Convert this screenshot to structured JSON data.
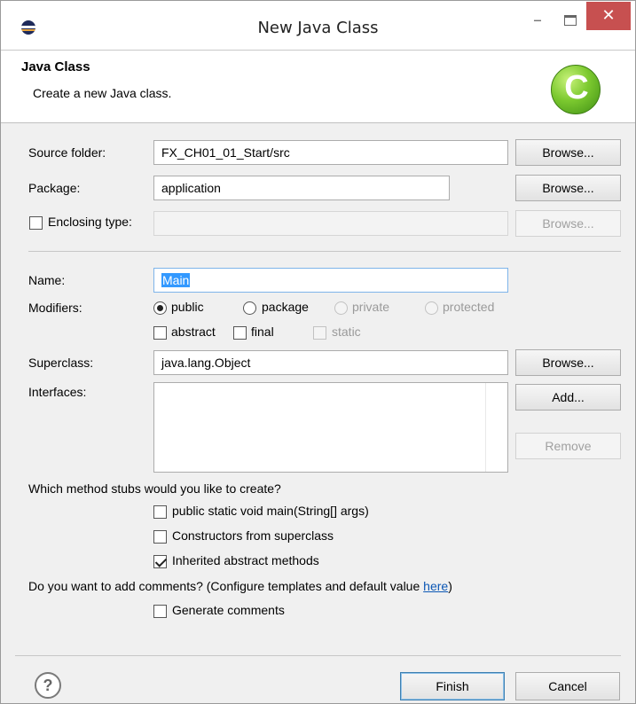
{
  "window": {
    "title": "New Java Class",
    "minimize_glyph": "–",
    "close_glyph": "✕",
    "icon": "eclipse-icon"
  },
  "banner": {
    "title": "Java Class",
    "description": "Create a new Java class.",
    "logo_letter": "C",
    "logo_icon": "java-class-icon"
  },
  "source_folder": {
    "label": "Source folder:",
    "value": "FX_CH01_01_Start/src",
    "browse": "Browse..."
  },
  "package": {
    "label": "Package:",
    "value": "application",
    "browse": "Browse..."
  },
  "enclosing_type": {
    "label": "Enclosing type:",
    "value": "",
    "browse": "Browse...",
    "checked": false,
    "enabled": false
  },
  "name": {
    "label": "Name:",
    "value": "Main"
  },
  "modifiers": {
    "label": "Modifiers:",
    "radios": [
      {
        "label": "public",
        "checked": true,
        "enabled": true
      },
      {
        "label": "package",
        "checked": false,
        "enabled": true
      },
      {
        "label": "private",
        "checked": false,
        "enabled": false
      },
      {
        "label": "protected",
        "checked": false,
        "enabled": false
      }
    ],
    "checkboxes": [
      {
        "label": "abstract",
        "checked": false,
        "enabled": true
      },
      {
        "label": "final",
        "checked": false,
        "enabled": true
      },
      {
        "label": "static",
        "checked": false,
        "enabled": false
      }
    ]
  },
  "superclass": {
    "label": "Superclass:",
    "value": "java.lang.Object",
    "browse": "Browse..."
  },
  "interfaces": {
    "label": "Interfaces:",
    "add": "Add...",
    "remove": "Remove",
    "items": []
  },
  "stubs": {
    "question": "Which method stubs would you like to create?",
    "options": [
      {
        "label": "public static void main(String[] args)",
        "checked": false
      },
      {
        "label": "Constructors from superclass",
        "checked": false
      },
      {
        "label": "Inherited abstract methods",
        "checked": true
      }
    ]
  },
  "comments": {
    "question": "Do you want to add comments? (Configure templates and default value ",
    "link": "here",
    "question_end": ")",
    "generate_label": "Generate comments",
    "checked": false
  },
  "footer": {
    "help_glyph": "?",
    "finish": "Finish",
    "cancel": "Cancel"
  },
  "colors": {
    "close_button": "#c75050",
    "selection": "#3399ff",
    "link": "#0b57b5",
    "logo_green": "#7cc92f"
  }
}
